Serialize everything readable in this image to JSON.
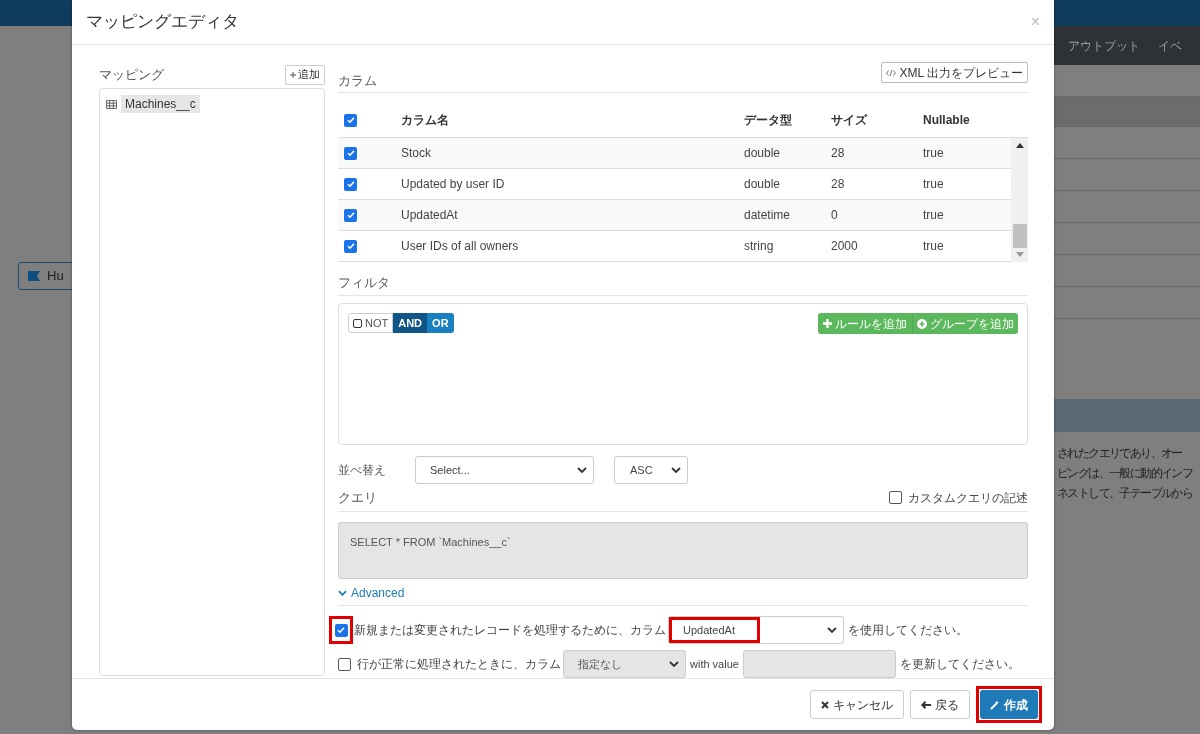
{
  "background": {
    "nav_tabs": [
      "アウトプット",
      "イベ"
    ],
    "card_label": "Hu",
    "text_lines": [
      "されたクエリであり、オー",
      "ピングは、一般に動的インフ",
      "ネストして、子テーブルから"
    ]
  },
  "modal": {
    "title": "マッピングエディタ",
    "close": "×",
    "mapping": {
      "label": "マッピング",
      "add_button": "追加",
      "items": [
        {
          "name": "Machines__c",
          "selected": true
        }
      ]
    },
    "columns": {
      "label": "カラム",
      "preview_button": "XML 出力をプレビュー",
      "all_checked": true,
      "headers": [
        "カラム名",
        "データ型",
        "サイズ",
        "Nullable"
      ],
      "rows": [
        {
          "checked": true,
          "name": "Stock",
          "type": "double",
          "size": "28",
          "nullable": "true"
        },
        {
          "checked": true,
          "name": "Updated by user ID",
          "type": "double",
          "size": "28",
          "nullable": "true"
        },
        {
          "checked": true,
          "name": "UpdatedAt",
          "type": "datetime",
          "size": "0",
          "nullable": "true"
        },
        {
          "checked": true,
          "name": "User IDs of all owners",
          "type": "string",
          "size": "2000",
          "nullable": "true"
        }
      ]
    },
    "filter": {
      "label": "フィルタ",
      "not_label": "NOT",
      "not_checked": false,
      "conditions": [
        {
          "label": "AND",
          "selected": true
        },
        {
          "label": "OR",
          "selected": false
        }
      ],
      "add_rule": "ルールを追加",
      "add_group": "グループを追加"
    },
    "sort": {
      "label": "並べ替え",
      "field": "Select...",
      "order": "ASC"
    },
    "query": {
      "label": "クエリ",
      "custom_label": "カスタムクエリの記述",
      "custom_checked": false,
      "text": "SELECT * FROM `Machines__c`"
    },
    "advanced": {
      "label": "Advanced",
      "expanded": true,
      "options": [
        {
          "kind": "use",
          "checked": true,
          "highlighted": true,
          "before": "新規または変更されたレコードを処理するために、カラム",
          "value": "UpdatedAt",
          "after": "を使用してください。"
        },
        {
          "kind": "update",
          "checked": false,
          "highlighted": false,
          "before": "行が正常に処理されたときに、カラム",
          "value": "指定なし",
          "with_label": "with value",
          "after": "を更新してください。"
        }
      ]
    },
    "buttons": [
      {
        "kind": "cancel",
        "label": "キャンセル",
        "highlighted": false
      },
      {
        "kind": "back",
        "label": "戻る",
        "highlighted": false
      },
      {
        "kind": "create",
        "label": "作成",
        "highlighted": true
      }
    ]
  }
}
